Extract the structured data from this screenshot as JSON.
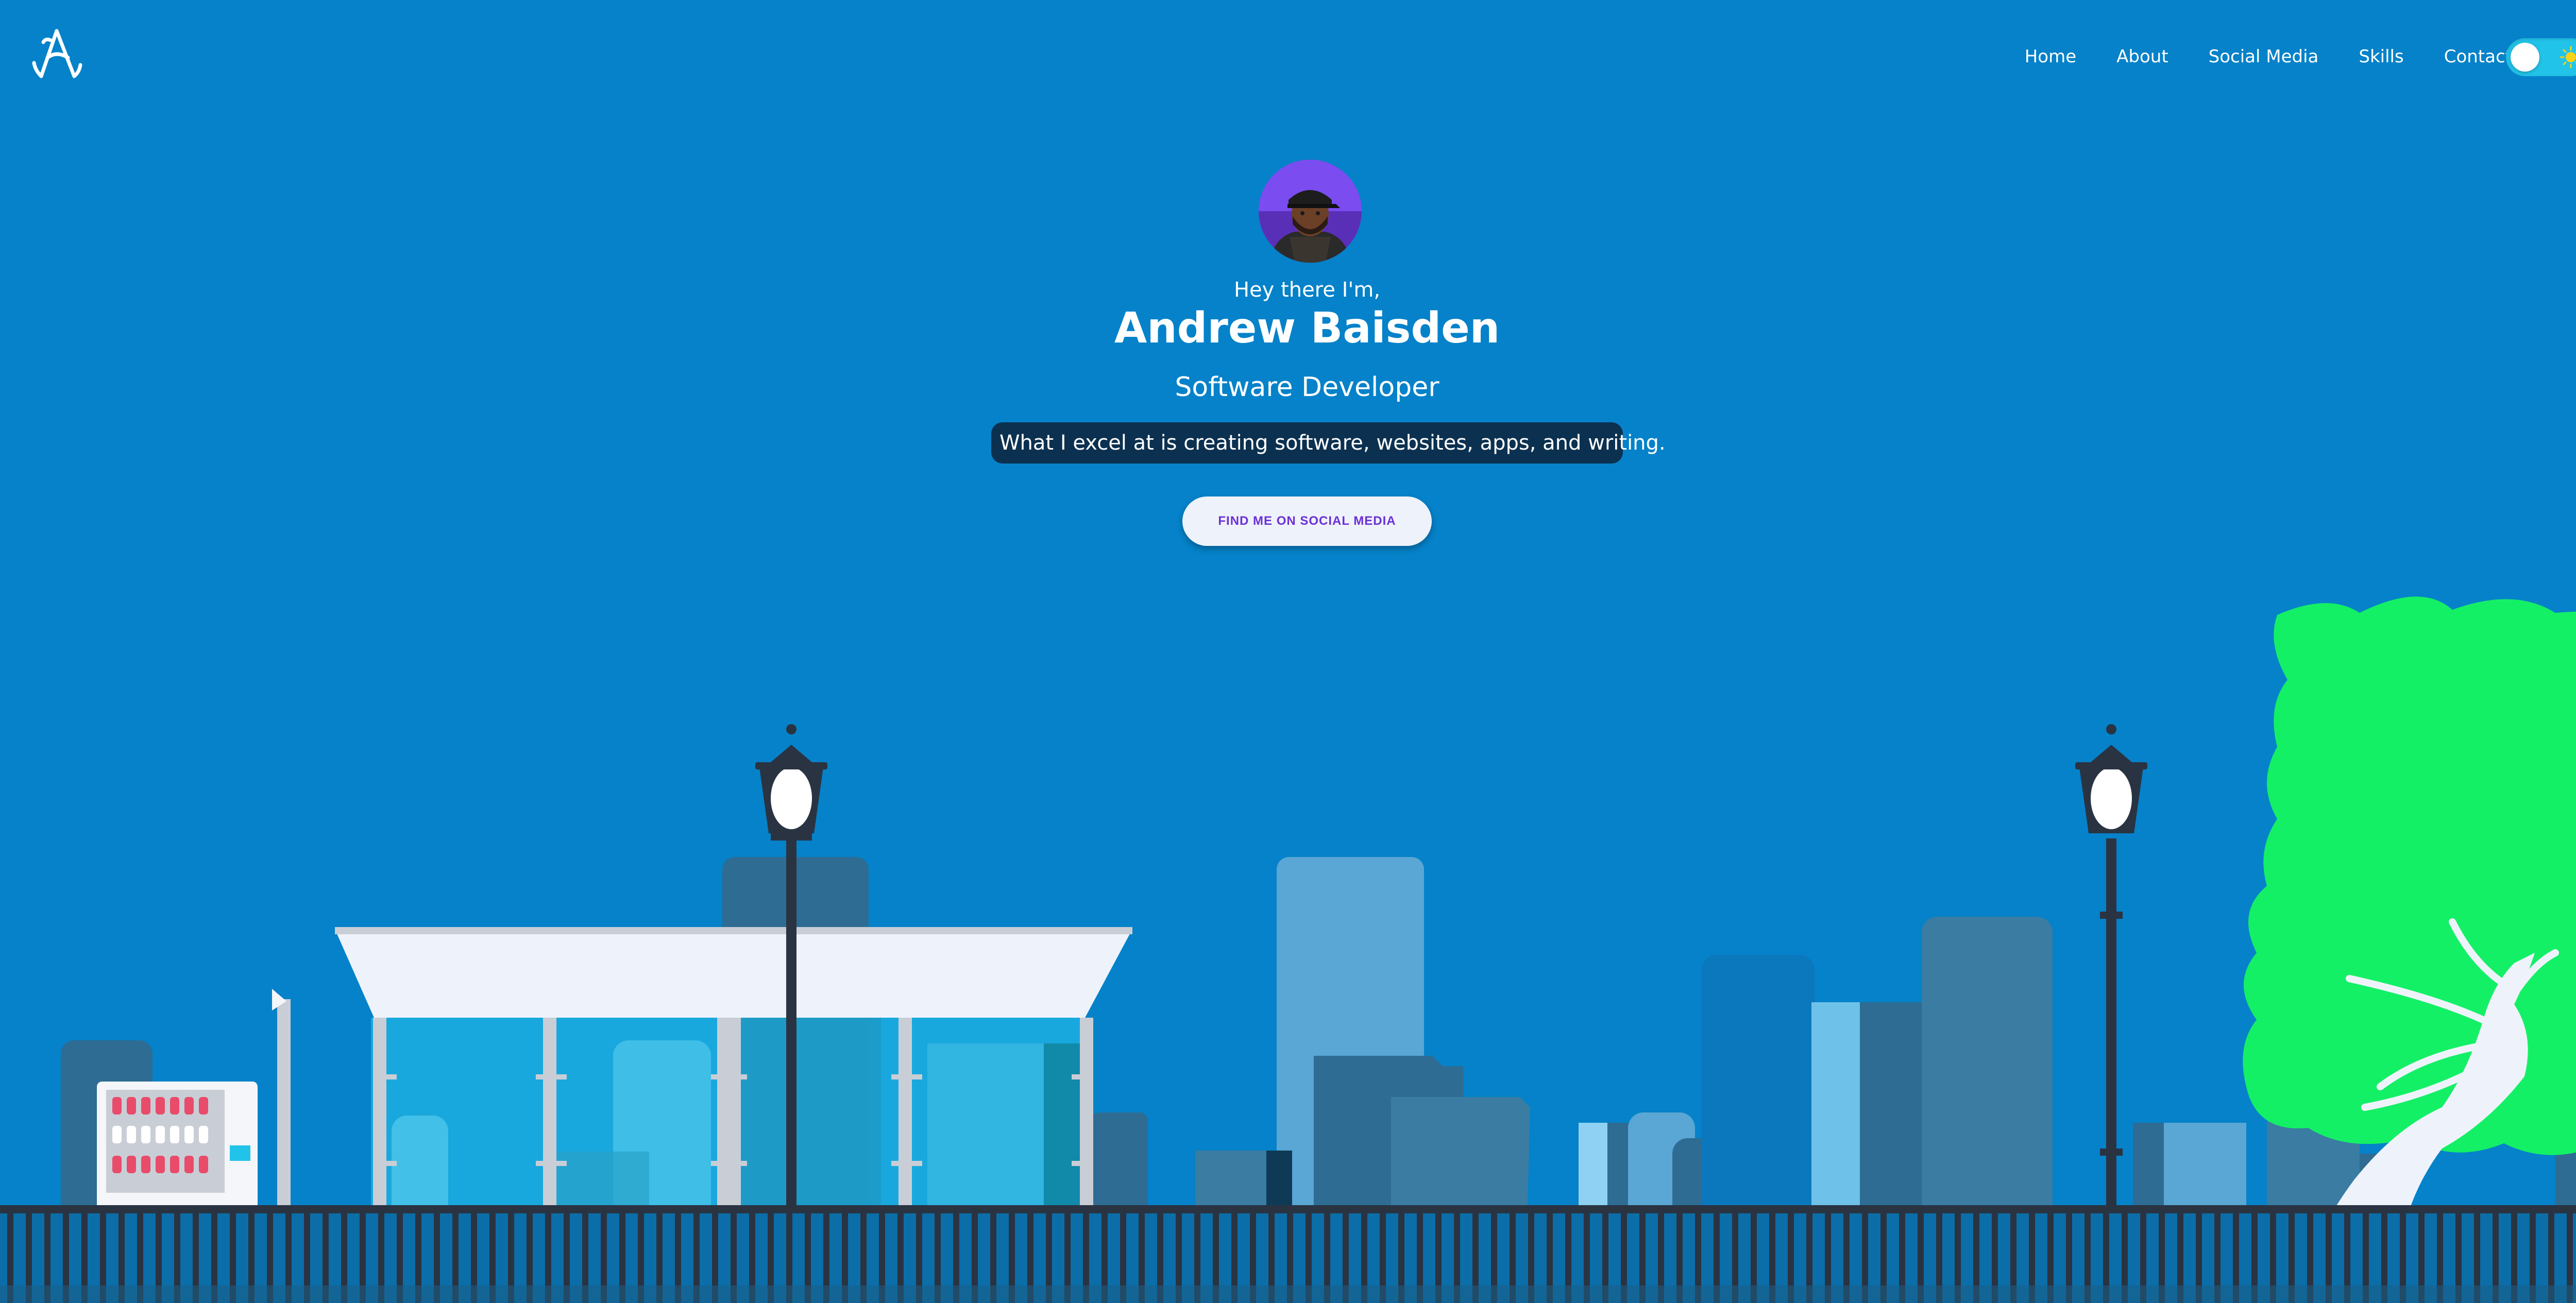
{
  "nav": {
    "logo_icon": "stylized-A-monogram-logo",
    "links": [
      "Home",
      "About",
      "Social Media",
      "Skills",
      "Contact"
    ],
    "theme_toggle": {
      "state": "light",
      "icon": "sun-icon"
    }
  },
  "hero": {
    "greeting": "Hey there I'm,",
    "name": "Andrew Baisden",
    "title": "Software Developer",
    "tagline": "What I excel at is creating software, websites, apps, and writing.",
    "cta_label": "FIND ME ON SOCIAL MEDIA",
    "avatar": "profile-photo"
  },
  "colors": {
    "background": "#0582c9",
    "tagline_bg": "#0c3150",
    "cta_text": "#6b2fd6",
    "toggle": "#22c3e8",
    "tree": "#14f066"
  }
}
